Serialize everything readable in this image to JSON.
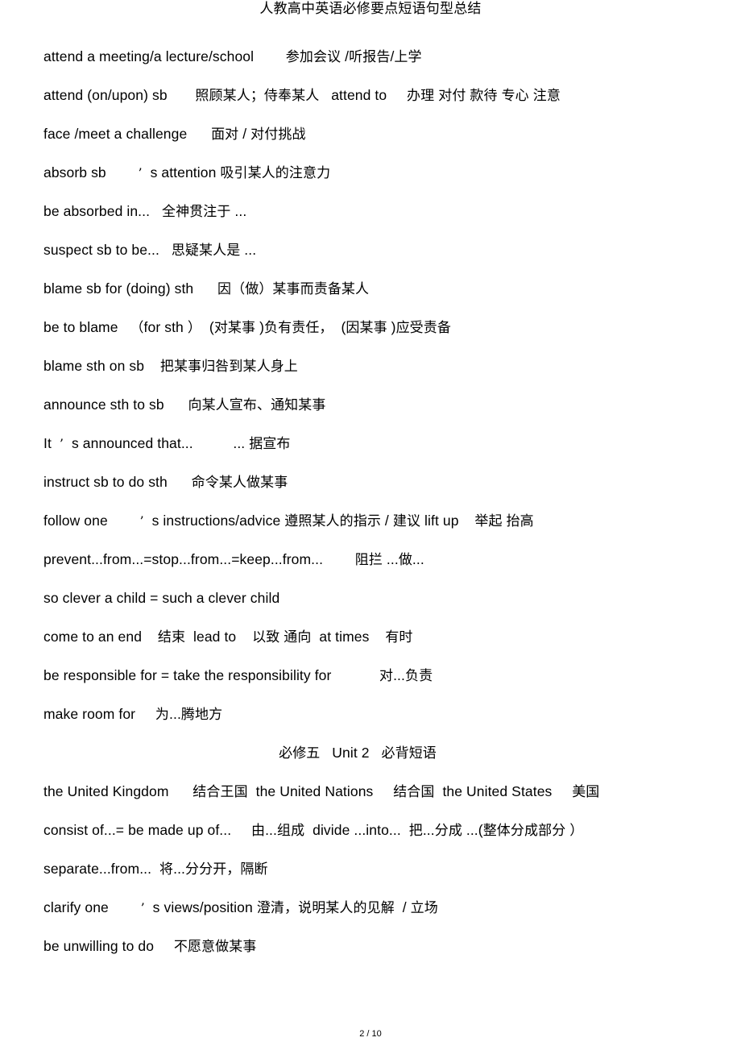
{
  "header": {
    "title": "人教高中英语必修要点短语句型总结"
  },
  "footer": {
    "page_label": "2 / 10"
  },
  "document": {
    "lines": [
      {
        "id": "attend-a-meeting",
        "text": "attend a meeting/a lecture/school        参加会议 /听报告/上学"
      },
      {
        "id": "attend-on-upon-sb",
        "text": "attend (on/upon) sb       照顾某人；侍奉某人   attend to     办理 对付 款待 专心 注意"
      },
      {
        "id": "face-meet-a-challenge",
        "text": "face /meet a challenge      面对 / 对付挑战"
      },
      {
        "id": "absorb-sb-attention",
        "text": "absorb sb        ’  s attention 吸引某人的注意力"
      },
      {
        "id": "be-absorbed-in",
        "text": "be absorbed in...   全神贯注于 ..."
      },
      {
        "id": "suspect-sb-to-be",
        "text": "suspect sb to be...   思疑某人是 ..."
      },
      {
        "id": "blame-sb-for-doing-sth",
        "text": "blame sb for (doing) sth      因（做）某事而责备某人"
      },
      {
        "id": "be-to-blame",
        "text": "be to blame   （for sth ）  (对某事 )负有责任，  (因某事 )应受责备"
      },
      {
        "id": "blame-sth-on-sb",
        "text": "blame sth on sb    把某事归咎到某人身上"
      },
      {
        "id": "announce-sth-to-sb",
        "text": "announce sth to sb      向某人宣布、通知某事"
      },
      {
        "id": "it-is-announced-that",
        "text": "It  ’  s announced that...          ... 据宣布"
      },
      {
        "id": "instruct-sb-to-do-sth",
        "text": "instruct sb to do sth      命令某人做某事"
      },
      {
        "id": "follow-ones-instructions",
        "text": "follow one        ’  s instructions/advice 遵照某人的指示 / 建议 lift up    举起 抬高"
      },
      {
        "id": "prevent-from-stop-keep",
        "text": "prevent...from...=stop...from...=keep...from...        阻拦 ...做..."
      },
      {
        "id": "so-clever-a-child",
        "text": "so clever a child = such a clever child"
      },
      {
        "id": "come-to-an-end",
        "text": "come to an end    结束  lead to    以致 通向  at times    有时"
      },
      {
        "id": "be-responsible-for",
        "text": "be responsible for = take the responsibility for            对...负责"
      },
      {
        "id": "make-room-for",
        "text": "make room for     为...腾地方"
      },
      {
        "id": "section-heading-unit2",
        "text": "必修五   Unit 2   必背短语",
        "center": true
      },
      {
        "id": "the-united-kingdom",
        "text": "the United Kingdom      结合王国  the United Nations     结合国  the United States     美国"
      },
      {
        "id": "consist-of-divide-into",
        "text": "consist of...= be made up of...     由...组成  divide ...into...  把...分成 ...(整体分成部分 ）"
      },
      {
        "id": "separate-from",
        "text": "separate...from...  将...分分开，隔断"
      },
      {
        "id": "clarify-ones-views",
        "text": "clarify one        ’  s views/position 澄清，说明某人的见解  / 立场"
      },
      {
        "id": "be-unwilling-to-do",
        "text": "be unwilling to do     不愿意做某事"
      }
    ]
  }
}
